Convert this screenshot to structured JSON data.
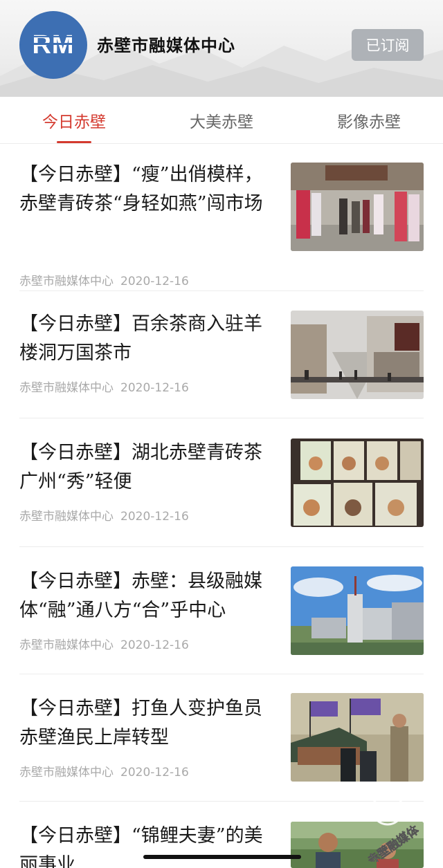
{
  "header": {
    "logo_text": "RM",
    "title": "赤壁市融媒体中心",
    "subscribe_label": "已订阅"
  },
  "tabs": [
    {
      "label": "今日赤壁",
      "active": true
    },
    {
      "label": "大美赤壁",
      "active": false
    },
    {
      "label": "影像赤壁",
      "active": false
    }
  ],
  "articles": [
    {
      "title": "【今日赤壁】“瘦”出俏模样，赤壁青砖茶“身轻如燕”闯市场",
      "source": "赤壁市融媒体中心",
      "date": "2020-12-16",
      "image": "tea-street-parade"
    },
    {
      "title": "【今日赤壁】百余茶商入驻羊楼洞万国茶市",
      "source": "赤壁市融媒体中心",
      "date": "2020-12-16",
      "image": "tea-market-street"
    },
    {
      "title": "【今日赤壁】湖北赤壁青砖茶广州“秀”轻便",
      "source": "赤壁市融媒体中心",
      "date": "2020-12-16",
      "image": "tea-packaging-boxes"
    },
    {
      "title": "【今日赤壁】赤壁：县级融媒体“融”通八方“合”乎中心",
      "source": "赤壁市融媒体中心",
      "date": "2020-12-16",
      "image": "city-tower-skyline"
    },
    {
      "title": "【今日赤壁】打鱼人变护鱼员 赤壁渔民上岸转型",
      "source": "赤壁市融媒体中心",
      "date": "2020-12-16",
      "image": "fishermen-boat-flags"
    },
    {
      "title": "【今日赤壁】“锦鲤夫妻”的美丽事业",
      "source": "",
      "date": "",
      "image": "couple-outdoors"
    }
  ],
  "watermark_text": "赤壁融媒体",
  "colors": {
    "accent": "#d43a2f",
    "logo_blue": "#3d6fb3",
    "button_gray": "#aeb2b7"
  }
}
